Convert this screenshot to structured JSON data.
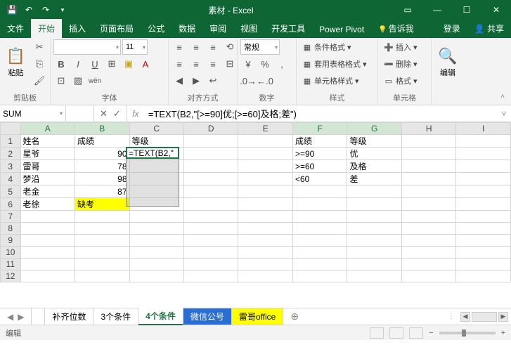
{
  "title": "素材 - Excel",
  "tabs": [
    "文件",
    "开始",
    "插入",
    "页面布局",
    "公式",
    "数据",
    "审阅",
    "视图",
    "开发工具",
    "Power Pivot"
  ],
  "tellme": "告诉我",
  "login": "登录",
  "share": "共享",
  "ribbon": {
    "clipboard": {
      "label": "剪贴板",
      "paste": "粘贴"
    },
    "font": {
      "label": "字体",
      "size": "11",
      "name": "",
      "bold": "B",
      "italic": "I",
      "underline": "U",
      "wen": "wén"
    },
    "alignment": {
      "label": "对齐方式"
    },
    "number": {
      "label": "数字",
      "format": "常规",
      "currency": "¥",
      "percent": "%",
      "comma": ","
    },
    "styles": {
      "label": "样式",
      "cond": "条件格式",
      "table": "套用表格格式",
      "cell": "单元格样式"
    },
    "cells": {
      "label": "单元格",
      "insert": "插入",
      "delete": "删除",
      "format": "格式"
    },
    "editing": {
      "label": "编辑"
    }
  },
  "namebox": "SUM",
  "formula": "=TEXT(B2,\"[>=90]优;[>=60]及格;差\")",
  "active_cell_display": "=TEXT(B2,\"",
  "cols": [
    "A",
    "B",
    "C",
    "D",
    "E",
    "F",
    "G",
    "H",
    "I"
  ],
  "rows": [
    "1",
    "2",
    "3",
    "4",
    "5",
    "6",
    "7",
    "8",
    "9",
    "10",
    "11",
    "12"
  ],
  "data": {
    "A1": "姓名",
    "B1": "成绩",
    "C1": "等级",
    "F1": "成绩",
    "G1": "等级",
    "A2": "星爷",
    "B2": "90",
    "F2": ">=90",
    "G2": "优",
    "A3": "雷哥",
    "B3": "78",
    "F3": ">=60",
    "G3": "及格",
    "A4": "梦沿",
    "B4": "98",
    "F4": "<60",
    "G4": "差",
    "A5": "老金",
    "B5": "87",
    "A6": "老徐",
    "B6": "缺考"
  },
  "sheets": [
    "补齐位数",
    "3个条件",
    "4个条件",
    "微信公号",
    "雷哥office"
  ],
  "status": "编辑",
  "zoom_text": ""
}
